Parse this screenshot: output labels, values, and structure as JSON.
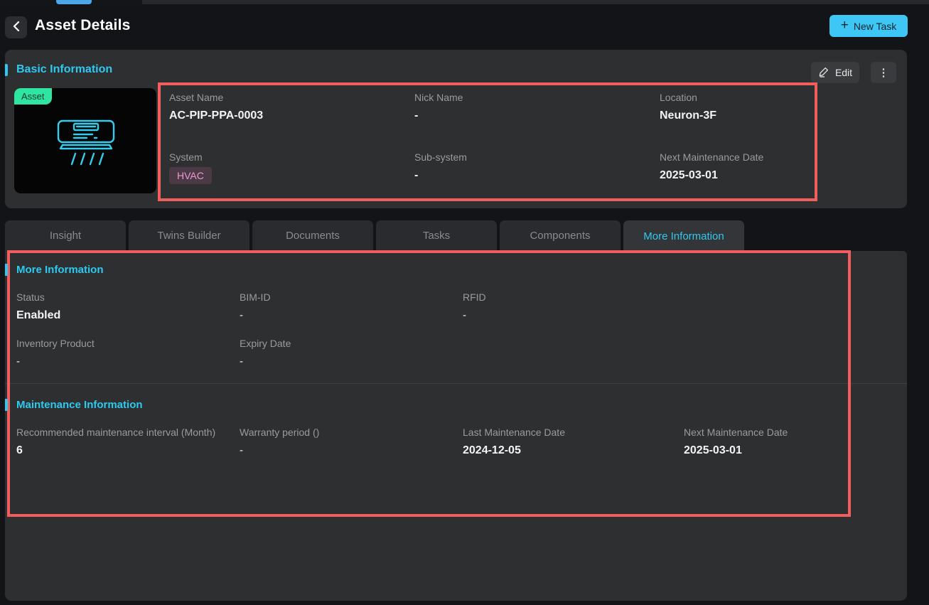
{
  "header": {
    "title": "Asset Details",
    "new_task_label": "New Task"
  },
  "icons": {
    "back_chevron": "‹",
    "plus": "+",
    "kebab": "⋮",
    "edit": "pencil-icon",
    "asset_image": "air-conditioner-icon"
  },
  "basic_info": {
    "title": "Basic Information",
    "edit_label": "Edit",
    "asset_badge_label": "Asset",
    "fields": [
      {
        "label": "Asset Name",
        "value": "AC-PIP-PPA-0003"
      },
      {
        "label": "Nick Name",
        "value": "-"
      },
      {
        "label": "Location",
        "value": "Neuron-3F"
      },
      {
        "label": "System",
        "value": "HVAC"
      },
      {
        "label": "Sub-system",
        "value": "-"
      },
      {
        "label": "Next Maintenance Date",
        "value": "2025-03-01"
      }
    ]
  },
  "tabs": [
    {
      "label": "Insight",
      "active": false
    },
    {
      "label": "Twins Builder",
      "active": false
    },
    {
      "label": "Documents",
      "active": false
    },
    {
      "label": "Tasks",
      "active": false
    },
    {
      "label": "Components",
      "active": false
    },
    {
      "label": "More Information",
      "active": true
    }
  ],
  "more_info": {
    "title": "More Information",
    "fields": [
      {
        "label": "Status",
        "value": "Enabled"
      },
      {
        "label": "BIM-ID",
        "value": "-"
      },
      {
        "label": "RFID",
        "value": "-"
      },
      {
        "label": "Inventory Product",
        "value": "-"
      },
      {
        "label": "Expiry Date",
        "value": "-"
      }
    ]
  },
  "maintenance_info": {
    "title": "Maintenance Information",
    "fields": [
      {
        "label": "Recommended maintenance interval (Month)",
        "value": "6"
      },
      {
        "label": "Warranty period ()",
        "value": "-"
      },
      {
        "label": "Last Maintenance Date",
        "value": "2024-12-05"
      },
      {
        "label": "Next Maintenance Date",
        "value": "2025-03-01"
      }
    ]
  },
  "colors": {
    "accent_cyan": "#2fc9f0",
    "annotation_red": "#f25e5e",
    "asset_badge_green": "#2ee5a1",
    "hvac_badge_bg": "#4b3a46",
    "hvac_badge_text": "#ee9bd3",
    "new_task_bg": "#3ec7f4",
    "card_bg": "#2e2f31",
    "page_bg": "#131417"
  }
}
